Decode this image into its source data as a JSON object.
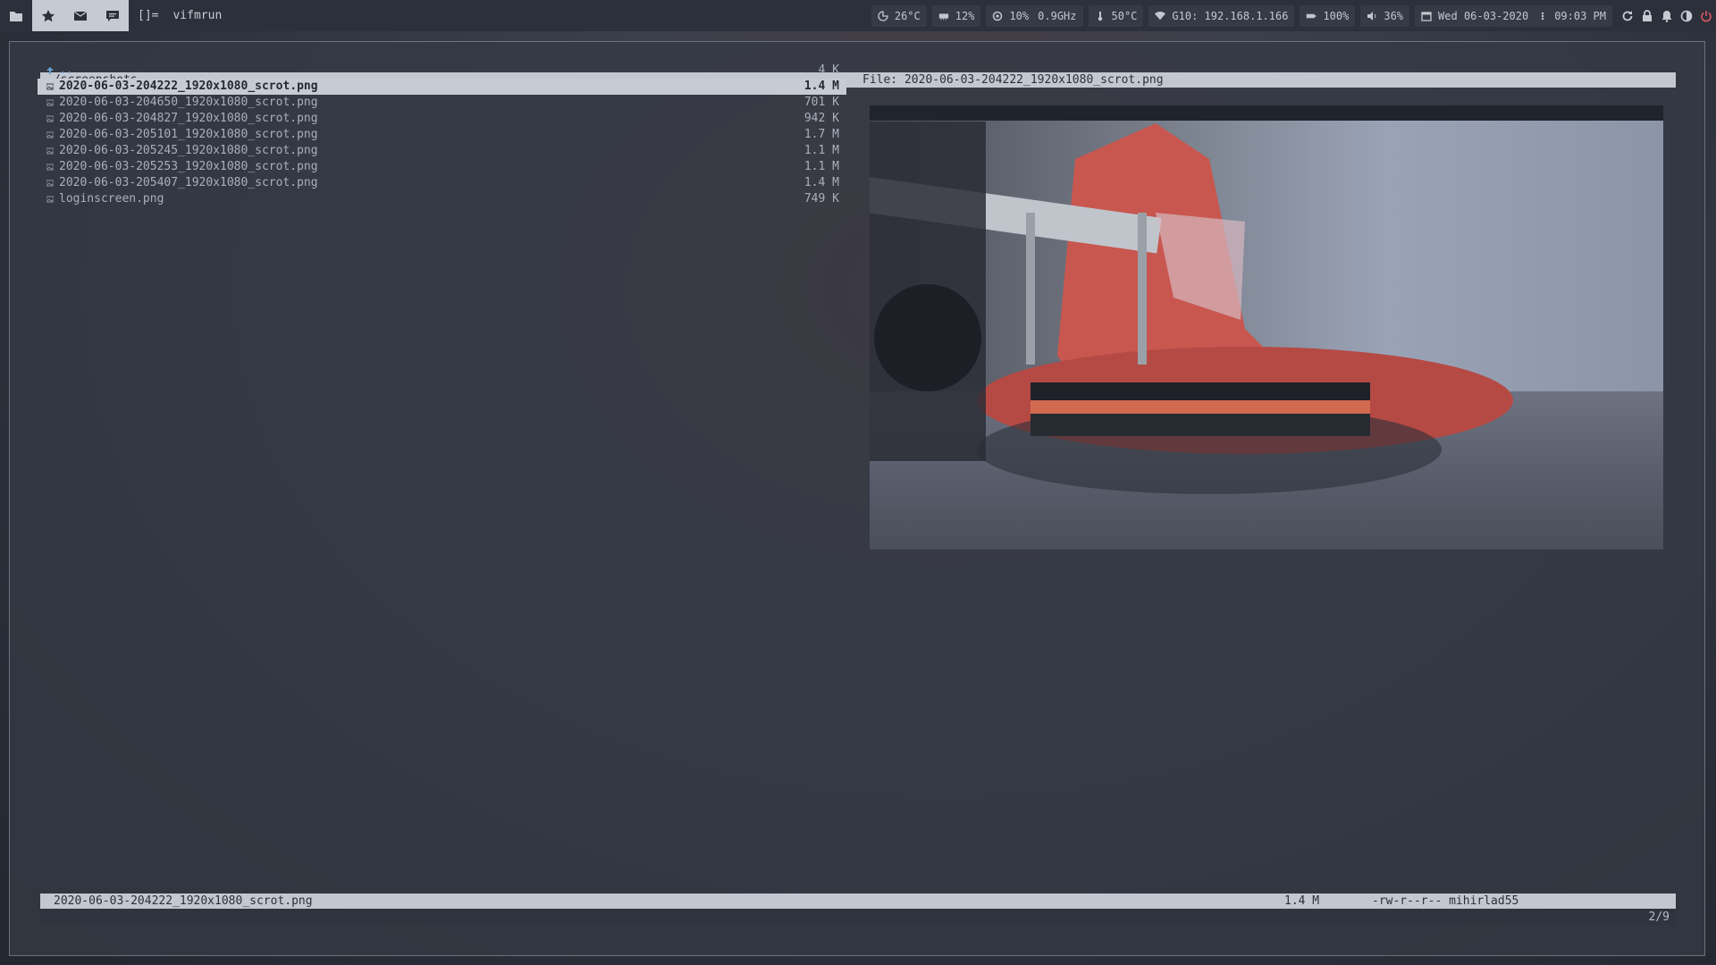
{
  "topbar": {
    "tags": [
      {
        "icon": "folder-icon",
        "active": false
      },
      {
        "icon": "star-icon",
        "active": true
      },
      {
        "icon": "mail-icon",
        "active": true
      },
      {
        "icon": "chat-icon",
        "active": true
      }
    ],
    "layout_symbol": "[]=",
    "window_title": "vifmrun"
  },
  "status": {
    "weather": "26°C",
    "memory": "12%",
    "cpu_usage": "10%",
    "cpu_freq": "0.9GHz",
    "temperature": "50°C",
    "wifi": "G10: 192.168.1.166",
    "battery": "100%",
    "volume": "36%",
    "date": "Wed 06-03-2020",
    "time": "09:03 PM"
  },
  "vifm": {
    "current_dir": "~/screenshots",
    "preview_title": "File: 2020-06-03-204222_1920x1080_scrot.png",
    "files": [
      {
        "name": "..",
        "size": "4 K",
        "type": "parent"
      },
      {
        "name": "2020-06-03-204222_1920x1080_scrot.png",
        "size": "1.4 M",
        "type": "image"
      },
      {
        "name": "2020-06-03-204650_1920x1080_scrot.png",
        "size": "701 K",
        "type": "image"
      },
      {
        "name": "2020-06-03-204827_1920x1080_scrot.png",
        "size": "942 K",
        "type": "image"
      },
      {
        "name": "2020-06-03-205101_1920x1080_scrot.png",
        "size": "1.7 M",
        "type": "image"
      },
      {
        "name": "2020-06-03-205245_1920x1080_scrot.png",
        "size": "1.1 M",
        "type": "image"
      },
      {
        "name": "2020-06-03-205253_1920x1080_scrot.png",
        "size": "1.1 M",
        "type": "image"
      },
      {
        "name": "2020-06-03-205407_1920x1080_scrot.png",
        "size": "1.4 M",
        "type": "image"
      },
      {
        "name": "loginscreen.png",
        "size": "749 K",
        "type": "image"
      }
    ],
    "status_line": {
      "filename": "2020-06-03-204222_1920x1080_scrot.png",
      "size": "1.4 M",
      "permissions_owner": "-rw-r--r-- mihirlad55"
    },
    "position": "2/9"
  },
  "colors": {
    "accent_light": "#c3c8d0",
    "bar_bg": "#2b303a",
    "power": "#e05560"
  }
}
